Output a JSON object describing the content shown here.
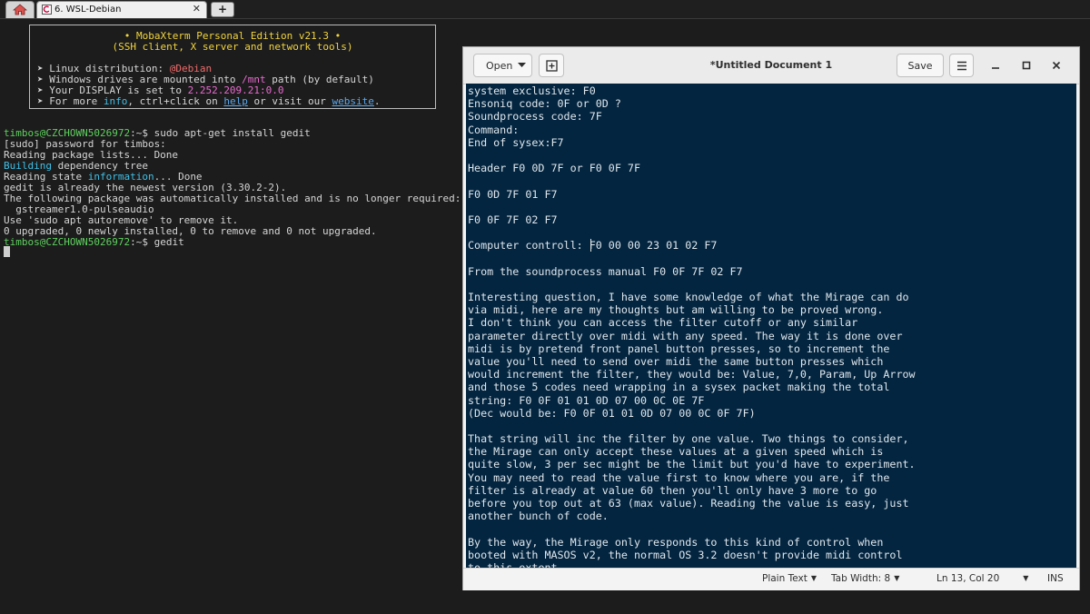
{
  "tabbar": {
    "home_icon": "home-icon",
    "session_tab_label": "6. WSL-Debian",
    "session_tab_icon": "debian-swirl-icon",
    "close_glyph": "✕",
    "new_tab_glyph": "+"
  },
  "terminal": {
    "banner": {
      "title": "• MobaXterm Personal Edition v21.3 •",
      "subtitle": "(SSH client, X server and network tools)",
      "linux_label": "➤ Linux distribution: ",
      "linux_value": "Debian",
      "drives_prefix": "➤ Windows drives are mounted into ",
      "drives_path": "/mnt",
      "drives_suffix": " path (by default)",
      "display_prefix": "➤ Your DISPLAY is set to ",
      "display_value": "2.252.209.21:0.0",
      "info_prefix": "➤ For more ",
      "info_word": "info",
      "info_mid": ", ctrl+click on ",
      "help_word": "help",
      "info_mid2": " or visit our ",
      "website_word": "website",
      "info_end": "."
    },
    "prompt_user": "timbos@CZCHOWN5026972",
    "prompt_sep": ":~$ ",
    "cmd1": "sudo apt-get install gedit",
    "line_password": "[sudo] password for timbos:",
    "line_reading_lists": "Reading package lists... Done",
    "building_word": "Building",
    "building_rest": " dependency tree",
    "reading_state_prefix": "Reading state ",
    "information_word": "information",
    "reading_state_suffix": "... Done",
    "line_newest": "gedit is already the newest version (3.30.2-2).",
    "line_following": "The following package was automatically installed and is no longer required:",
    "line_package": "  gstreamer1.0-pulseaudio",
    "line_autoremove": "Use 'sudo apt autoremove' to remove it.",
    "line_summary": "0 upgraded, 0 newly installed, 0 to remove and 0 not upgraded.",
    "cmd2": "gedit"
  },
  "gedit": {
    "open_label": "Open",
    "new_doc_icon": "new-document-icon",
    "title": "*Untitled Document 1",
    "save_label": "Save",
    "menu_icon": "hamburger-menu-icon",
    "lines": [
      "system exclusive: F0",
      "Ensoniq code: 0F or 0D ?",
      "Soundprocess code: 7F",
      "Command:",
      "End of sysex:F7",
      "",
      "Header F0 0D 7F or F0 0F 7F",
      "",
      "F0 0D 7F 01 F7",
      "",
      "F0 0F 7F 02 F7",
      "",
      "Computer controll: F0 00 00 23 01 02 F7",
      "",
      "From the soundprocess manual F0 0F 7F 02 F7",
      "",
      "Interesting question, I have some knowledge of what the Mirage can do",
      "via midi, here are my thoughts but am willing to be proved wrong.",
      "I don't think you can access the filter cutoff or any similar",
      "parameter directly over midi with any speed. The way it is done over",
      "midi is by pretend front panel button presses, so to increment the",
      "value you'll need to send over midi the same button presses which",
      "would increment the filter, they would be: Value, 7,0, Param, Up Arrow",
      "and those 5 codes need wrapping in a sysex packet making the total",
      "string: F0 0F 01 01 0D 07 00 0C 0E 7F",
      "(Dec would be: F0 0F 01 01 0D 07 00 0C 0F 7F)",
      "",
      "That string will inc the filter by one value. Two things to consider,",
      "the Mirage can only accept these values at a given speed which is",
      "quite slow, 3 per sec might be the limit but you'd have to experiment.",
      "You may need to read the value first to know where you are, if the",
      "filter is already at value 60 then you'll only have 3 more to go",
      "before you top out at 63 (max value). Reading the value is easy, just",
      "another bunch of code.",
      "",
      "By the way, the Mirage only responds to this kind of control when",
      "booted with MASOS v2, the normal OS 3.2 doesn't provide midi control",
      "to this extent"
    ],
    "status": {
      "language": "Plain Text",
      "tab_width": "Tab Width: 8",
      "position": "Ln 13, Col 20",
      "mode": "INS"
    }
  },
  "colors": {
    "terminal_bg": "#1c1c1c",
    "editor_bg": "#04253f",
    "prompt_green": "#5ed15e",
    "banner_yellow": "#f2d43c"
  }
}
